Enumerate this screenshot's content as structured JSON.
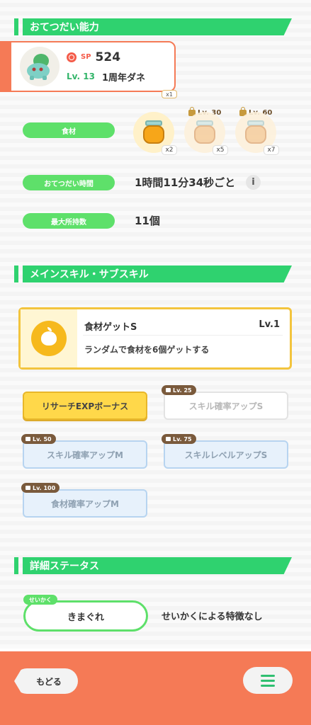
{
  "sections": {
    "helping": "おてつだい能力",
    "skills": "メインスキル・サブスキル",
    "details": "詳細ステータス"
  },
  "profile": {
    "sp_label": "SP",
    "sp_value": "524",
    "level": "Lv. 13",
    "nickname": "1周年ダネ",
    "top_qty": "x1"
  },
  "stats": {
    "ingredients_label": "食材",
    "help_time_label": "おてつだい時間",
    "help_time_value": "1時間11分34秒ごと",
    "max_carry_label": "最大所持数",
    "max_carry_value": "11個",
    "info_icon": "i"
  },
  "ingredients": [
    {
      "qty": "x2",
      "lock": ""
    },
    {
      "qty": "x5",
      "lock": "Lv. 30"
    },
    {
      "qty": "x7",
      "lock": "Lv. 60"
    }
  ],
  "main_skill": {
    "name": "食材ゲットS",
    "level": "Lv.1",
    "description": "ランダムで食材を6個ゲットする"
  },
  "sub_skills": [
    {
      "label": "リサーチEXPボーナス",
      "lock": ""
    },
    {
      "label": "スキル確率アップS",
      "lock": "Lv. 25"
    },
    {
      "label": "スキル確率アップM",
      "lock": "Lv. 50"
    },
    {
      "label": "スキルレベルアップS",
      "lock": "Lv. 75"
    },
    {
      "label": "食材確率アップM",
      "lock": "Lv. 100"
    }
  ],
  "nature": {
    "tag": "せいかく",
    "value": "きまぐれ",
    "effect": "せいかくによる特徴なし"
  },
  "footer": {
    "back": "もどる"
  }
}
